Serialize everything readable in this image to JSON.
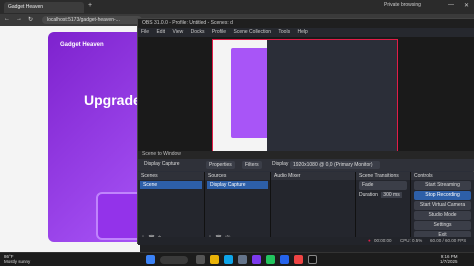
{
  "browser": {
    "tab_title": "Gadget Heaven",
    "tab2_title": "",
    "private_label": "Private browsing",
    "address": "localhost:5173/gadget-heaven-...",
    "page": {
      "brand": "Gadget Heaven",
      "headline": "Upgrade"
    }
  },
  "obs": {
    "title": "OBS 31.0.0 - Profile: Untitled - Scenes: d",
    "menu": [
      "File",
      "Edit",
      "View",
      "Docks",
      "Profile",
      "Scene Collection",
      "Tools",
      "Help"
    ],
    "scene_name_label": "Scene to Window",
    "toolbar": {
      "source_name": "Display Capture",
      "properties": "Properties",
      "filters": "Filters",
      "display_label": "Display",
      "display_value": "1920x1080 @ 0,0 (Primary Monitor)"
    },
    "docks": {
      "scenes": {
        "title": "Scenes",
        "items": [
          "Scene"
        ]
      },
      "sources": {
        "title": "Sources",
        "items": [
          "Display Capture"
        ]
      },
      "audio": {
        "title": "Audio Mixer"
      },
      "transitions": {
        "title": "Scene Transitions",
        "type": "Fade",
        "duration_label": "Duration",
        "duration_value": "300 ms"
      },
      "controls": {
        "title": "Controls",
        "buttons": [
          "Start Streaming",
          "Stop Recording",
          "Start Virtual Camera",
          "Studio Mode",
          "Settings",
          "Exit"
        ]
      }
    },
    "status": {
      "rec": "00:00:00",
      "stream": "00:00:00",
      "cpu": "CPU: 0.5%",
      "fps": "60.00 / 60.00 FPS"
    }
  },
  "taskbar": {
    "weather_temp": "86°F",
    "weather_desc": "Mostly sunny",
    "time": "9:16 PM",
    "date": "1/7/2025"
  },
  "colors": {
    "accent": "#a855f7",
    "obs_blue": "#2d5fa8",
    "record_red": "#e11d48"
  }
}
